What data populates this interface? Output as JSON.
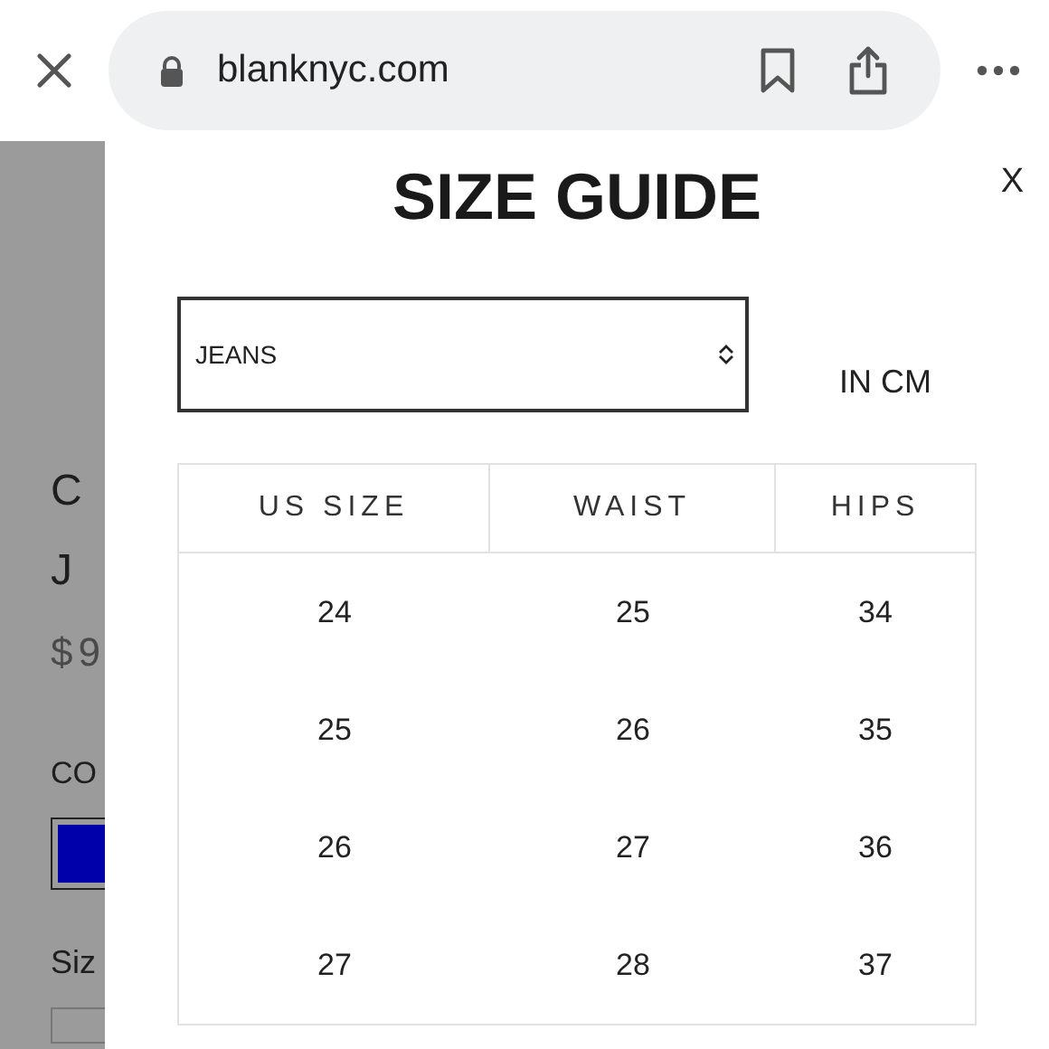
{
  "browser": {
    "url": "blanknyc.com"
  },
  "background_page": {
    "title_line_1": "C",
    "title_line_2": "J",
    "price": "$9",
    "color_label": "CO",
    "swatch": {
      "color": "#0000aa"
    },
    "size_label": "Siz"
  },
  "size_guide": {
    "title": "SIZE GUIDE",
    "close": "X",
    "category": {
      "value": "JEANS"
    },
    "unit": "IN CM",
    "table": {
      "columns": [
        "US SIZE",
        "WAIST",
        "HIPS"
      ],
      "rows": [
        [
          "24",
          "25",
          "34"
        ],
        [
          "25",
          "26",
          "35"
        ],
        [
          "26",
          "27",
          "36"
        ],
        [
          "27",
          "28",
          "37"
        ]
      ]
    }
  }
}
